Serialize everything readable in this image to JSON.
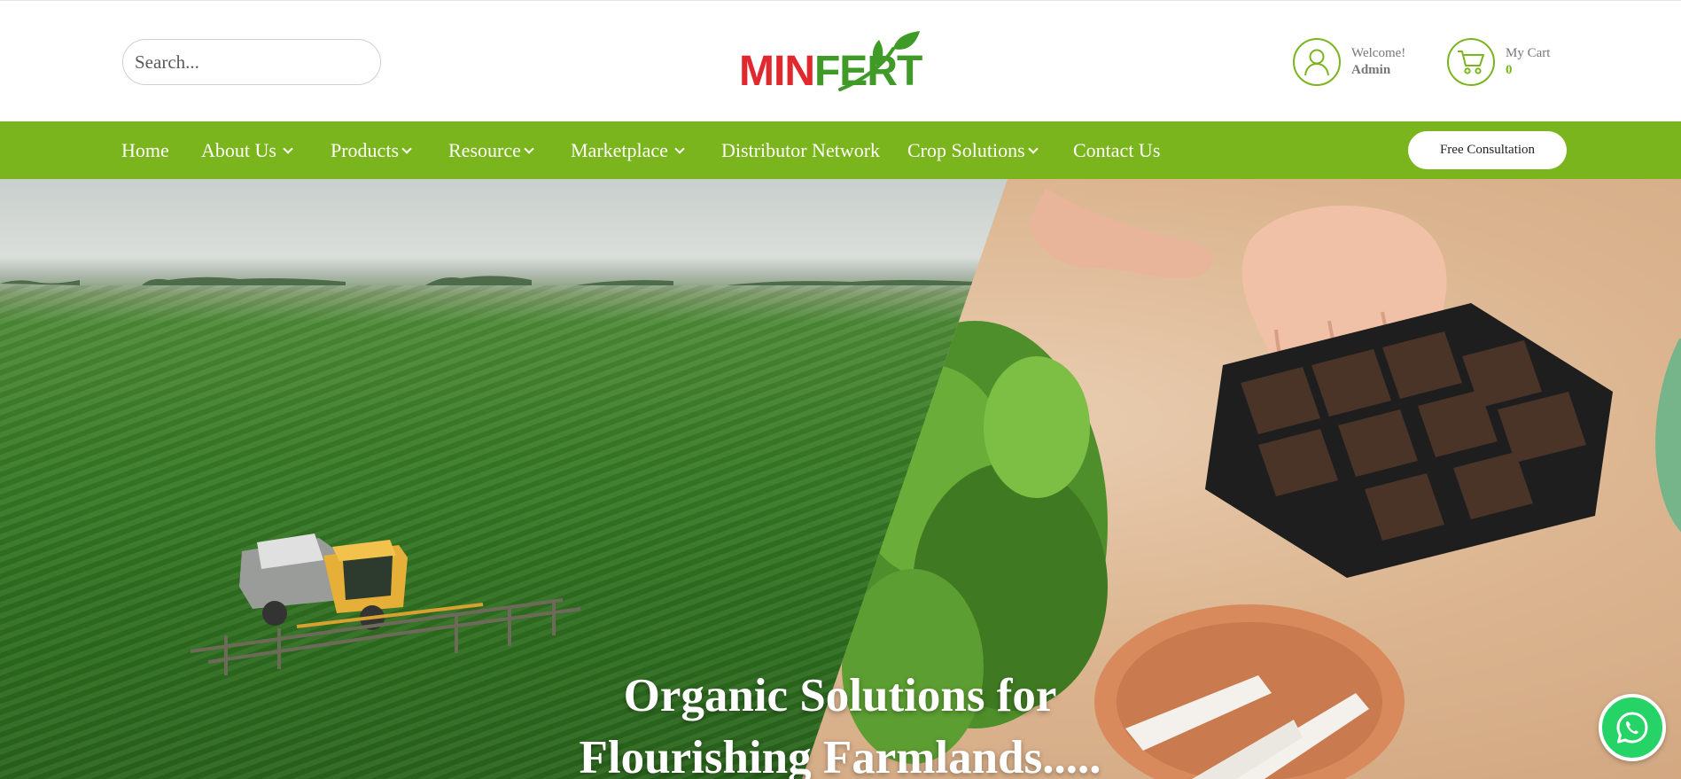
{
  "header": {
    "search": {
      "placeholder": "Search..."
    },
    "logo": {
      "part1": "MIN",
      "part2": "FERT"
    },
    "user": {
      "welcome": "Welcome!",
      "name": "Admin"
    },
    "cart": {
      "label": "My Cart",
      "count": "0"
    }
  },
  "nav": {
    "items": [
      {
        "label": "Home",
        "has_dropdown": false
      },
      {
        "label": "About Us",
        "has_dropdown": true
      },
      {
        "label": "Products",
        "has_dropdown": true
      },
      {
        "label": "Resource",
        "has_dropdown": true
      },
      {
        "label": "Marketplace",
        "has_dropdown": true
      },
      {
        "label": "Distributor Network",
        "has_dropdown": false
      },
      {
        "label": "Crop Solutions",
        "has_dropdown": true
      },
      {
        "label": "Contact Us",
        "has_dropdown": false
      }
    ],
    "cta": "Free Consultation"
  },
  "hero": {
    "title_line1": "Organic Solutions for",
    "title_line2": "Flourishing Farmlands....."
  },
  "icons": {
    "user": "user-icon",
    "cart": "cart-icon",
    "whatsapp": "whatsapp-icon",
    "chevron": "chevron-down-icon"
  },
  "colors": {
    "brand_green": "#7ab51d",
    "logo_red": "#e0282e",
    "logo_green": "#3f9a27",
    "whatsapp_green": "#25d366"
  }
}
